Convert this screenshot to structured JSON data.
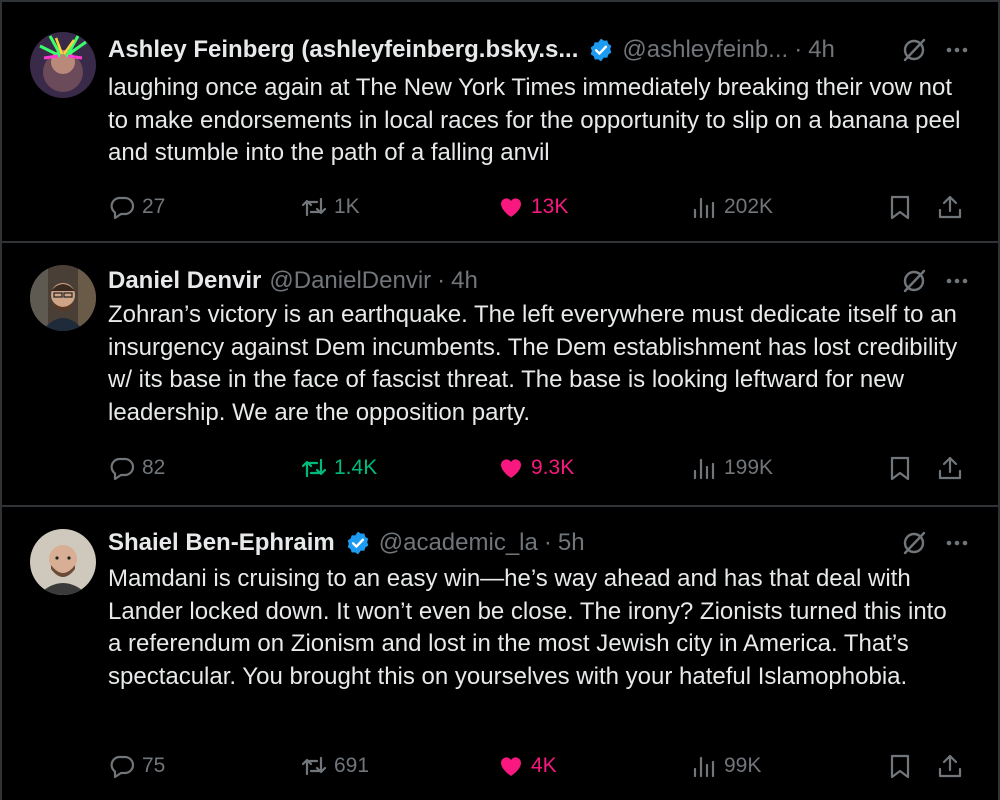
{
  "colors": {
    "background": "#000000",
    "text": "#e7e9ea",
    "muted": "#71767b",
    "like_active": "#f91880",
    "retweet_active": "#00ba7c",
    "verified": "#1d9bf0"
  },
  "tweets": [
    {
      "name": "Ashley Feinberg (ashleyfeinberg.bsky.s...",
      "verified": true,
      "handle": "@ashleyfeinb...",
      "time": "4h",
      "text": "laughing once again at The New York Times immediately breaking their vow not to make endorsements in local races for the opportunity to slip on a banana peel and stumble into the path of a falling anvil",
      "replies": "27",
      "retweets": "1K",
      "likes": "13K",
      "views": "202K",
      "liked": true,
      "retweeted": false
    },
    {
      "name": "Daniel Denvir",
      "verified": false,
      "handle": "@DanielDenvir",
      "time": "4h",
      "text": "Zohran’s victory is an earthquake. The left everywhere must dedicate itself to an insurgency against Dem incumbents. The Dem establishment has lost credibility w/ its base in the face of fascist threat. The base is looking leftward for new leadership. We are the opposition party.",
      "replies": "82",
      "retweets": "1.4K",
      "likes": "9.3K",
      "views": "199K",
      "liked": true,
      "retweeted": true
    },
    {
      "name": "Shaiel Ben-Ephraim",
      "verified": true,
      "handle": "@academic_la",
      "time": "5h",
      "text": "Mamdani is cruising to an easy win—he’s way ahead and has that deal with Lander locked down. It won’t even be close. The irony? Zionists turned this into a referendum on Zionism and lost in the most Jewish city in America. That’s spectacular. You brought this on yourselves with your hateful Islamophobia.",
      "replies": "75",
      "retweets": "691",
      "likes": "4K",
      "views": "99K",
      "liked": true,
      "retweeted": false
    }
  ],
  "icons": {
    "verified": "verified-badge-icon",
    "grok": "grok-icon",
    "more": "more-icon",
    "reply": "reply-icon",
    "retweet": "retweet-icon",
    "like": "heart-icon",
    "views": "views-icon",
    "bookmark": "bookmark-icon",
    "share": "share-icon"
  }
}
